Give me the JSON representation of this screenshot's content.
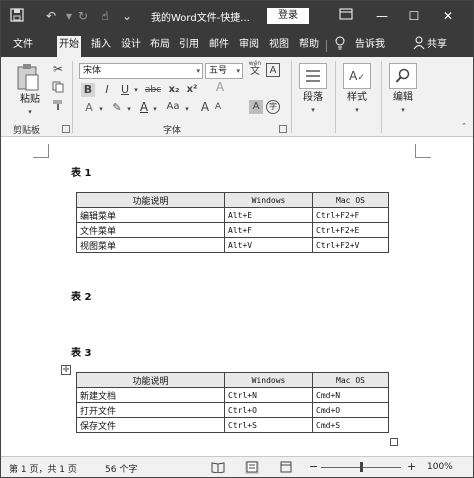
{
  "titlebar": {
    "title": "我的Word文件-快捷...",
    "login_label": "登录",
    "icons": [
      "save-icon",
      "undo-icon",
      "redo-icon",
      "touch-mode-icon",
      "customize-toolbar-icon",
      "ribbon-display-icon",
      "minimize-icon",
      "restore-icon",
      "close-icon"
    ]
  },
  "tabs": [
    "文件",
    "开始",
    "插入",
    "设计",
    "布局",
    "引用",
    "邮件",
    "审阅",
    "视图",
    "帮助"
  ],
  "active_tab": "开始",
  "tell_me_label": "告诉我",
  "share_label": "共享",
  "ribbon": {
    "clipboard": {
      "paste_label": "粘贴",
      "group_label": "剪贴板"
    },
    "font": {
      "font_name": "宋体",
      "font_size": "五号",
      "wen_label": "wén",
      "wen_char": "文",
      "bold": "B",
      "italic": "I",
      "underline": "U",
      "strike": "abc",
      "subscript": "x₂",
      "superscript": "x²",
      "clear_format": "A",
      "font_color": "A",
      "change_case": "Aa",
      "grow": "A",
      "shrink": "A",
      "char_shading": "A",
      "enclose": "字",
      "group_label": "字体"
    },
    "paragraph_label": "段落",
    "styles_label": "样式",
    "editing_label": "编辑"
  },
  "document": {
    "tables": [
      {
        "caption": "表 1",
        "header": [
          "功能说明",
          "Windows",
          "Mac OS"
        ],
        "rows": [
          [
            "编辑菜单",
            "Alt+E",
            "Ctrl+F2+F"
          ],
          [
            "文件菜单",
            "Alt+F",
            "Ctrl+F2+E"
          ],
          [
            "视图菜单",
            "Alt+V",
            "Ctrl+F2+V"
          ]
        ]
      },
      {
        "caption": "表 2"
      },
      {
        "caption": "表 3",
        "header": [
          "功能说明",
          "Windows",
          "Mac OS"
        ],
        "rows": [
          [
            "新建文档",
            "Ctrl+N",
            "Cmd+N"
          ],
          [
            "打开文件",
            "Ctrl+O",
            "Cmd+O"
          ],
          [
            "保存文件",
            "Ctrl+S",
            "Cmd+S"
          ]
        ]
      }
    ]
  },
  "status": {
    "page": "第 1 页，共 1 页",
    "words": "56 个字",
    "zoom_minus": "−",
    "zoom_plus": "+",
    "zoom": "100%",
    "zoom_percent_value": 100
  }
}
